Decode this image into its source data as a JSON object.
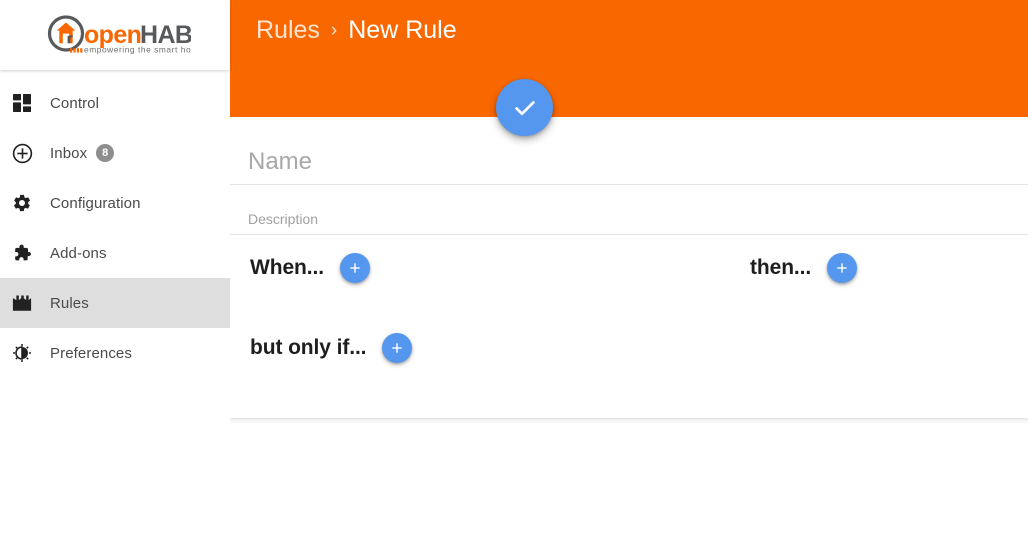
{
  "brand": {
    "logo_text_open": "open",
    "logo_text_hab": "HAB",
    "logo_tagline": "empowering the smart home",
    "orange": "#F96800",
    "dark_gray": "#58595B",
    "accent_blue": "#5596EE"
  },
  "sidebar": {
    "items": [
      {
        "label": "Control",
        "icon": "dashboard-icon",
        "badge": null,
        "active": false
      },
      {
        "label": "Inbox",
        "icon": "plus-circle-icon",
        "badge": "8",
        "active": false
      },
      {
        "label": "Configuration",
        "icon": "gear-icon",
        "badge": null,
        "active": false
      },
      {
        "label": "Add-ons",
        "icon": "puzzle-piece-icon",
        "badge": null,
        "active": false
      },
      {
        "label": "Rules",
        "icon": "clapper-icon",
        "badge": null,
        "active": true
      },
      {
        "label": "Preferences",
        "icon": "brightness-icon",
        "badge": null,
        "active": false
      }
    ]
  },
  "header": {
    "breadcrumb_parent": "Rules",
    "breadcrumb_separator": "›",
    "breadcrumb_current": "New Rule",
    "save_button_icon": "check-icon",
    "save_button_title": "Save"
  },
  "form": {
    "name_placeholder": "Name",
    "name_value": "",
    "description_placeholder": "Description",
    "description_value": ""
  },
  "modules": {
    "when_label": "When...",
    "when_add_icon": "plus-icon",
    "then_label": "then...",
    "then_add_icon": "plus-icon",
    "but_only_if_label": "but only if...",
    "but_only_if_add_icon": "plus-icon"
  }
}
